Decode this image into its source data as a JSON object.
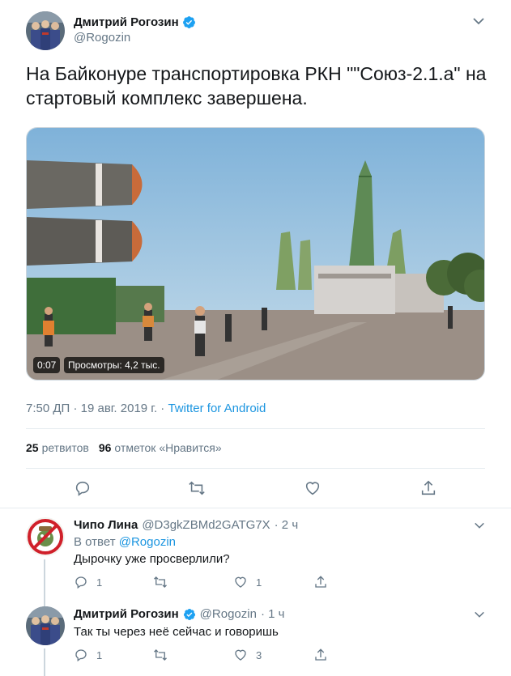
{
  "main": {
    "author_name": "Дмитрий Рогозин",
    "author_handle": "@Rogozin",
    "text": "На Байконуре транспортировка РКН \"\"Союз-2.1.а\" на стартовый комплекс завершена.",
    "video": {
      "time": "0:07",
      "views": "Просмотры: 4,2 тыс."
    },
    "timestamp": "7:50 ДП · 19 авг. 2019 г. ·",
    "source": "Twitter for Android",
    "retweets_count": "25",
    "retweets_label": "ретвитов",
    "likes_count": "96",
    "likes_label": "отметок «Нравится»"
  },
  "replies": [
    {
      "name": "Чипо Лина",
      "handle": "@D3gkZBMd2GATG7X",
      "time": "· 2 ч",
      "reply_to_label": "В ответ",
      "reply_to_handle": "@Rogozin",
      "text": "Дырочку уже просверлили?",
      "reply_count": "1",
      "retweet_count": "",
      "like_count": "1"
    },
    {
      "name": "Дмитрий Рогозин",
      "handle": "@Rogozin",
      "time": "· 1 ч",
      "text": "Так ты через неё сейчас и говоришь",
      "reply_count": "1",
      "retweet_count": "",
      "like_count": "3"
    }
  ],
  "colors": {
    "accent": "#1da1f2",
    "link": "#1b95e0",
    "muted": "#657786"
  }
}
